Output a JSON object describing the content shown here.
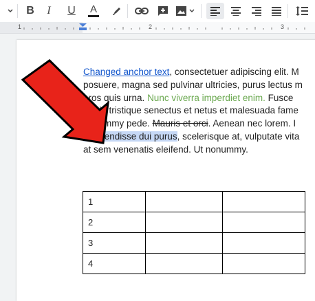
{
  "toolbar": {
    "buttons": [
      {
        "name": "bold-button",
        "label": "B"
      },
      {
        "name": "italic-button",
        "label": "I"
      },
      {
        "name": "underline-button",
        "label": "U"
      },
      {
        "name": "text-color-button",
        "label": "A"
      }
    ],
    "accent_color": "#1a1a1a"
  },
  "ruler": {
    "numbers": [
      "1",
      "2",
      "3"
    ]
  },
  "document": {
    "lines": [
      {
        "parts": [
          {
            "text": "Changed anchor text",
            "style": "link"
          },
          {
            "text": ", consectetuer adipiscing elit. M",
            "style": "normal"
          }
        ]
      },
      {
        "parts": [
          {
            "text": "posuere, magna sed pulvinar ultricies, purus lectus m",
            "style": "normal"
          }
        ]
      },
      {
        "parts": [
          {
            "text": "eros quis urna. ",
            "style": "normal"
          },
          {
            "text": "Nunc viverra imperdiet enim.",
            "style": "green"
          },
          {
            "text": " Fusce",
            "style": "normal"
          }
        ]
      },
      {
        "parts": [
          {
            "text": "Morbi tristique senectus et netus et malesuada fame",
            "style": "normal"
          }
        ]
      },
      {
        "parts": [
          {
            "text": "nonummy pede. ",
            "style": "normal"
          },
          {
            "text": "Mauris et orci",
            "style": "strike"
          },
          {
            "text": ". Aenean nec lorem. I",
            "style": "normal"
          }
        ]
      },
      {
        "parts": [
          {
            "text": "Suspendisse dui purus",
            "style": "selected"
          },
          {
            "text": ", scelerisque at, vulputate vita",
            "style": "normal"
          }
        ]
      },
      {
        "parts": [
          {
            "text": "at sem venenatis eleifend. Ut nonummy.",
            "style": "normal"
          }
        ]
      }
    ],
    "table_rows": [
      [
        "1",
        "",
        ""
      ],
      [
        "2",
        "",
        ""
      ],
      [
        "3",
        "",
        ""
      ],
      [
        "4",
        "",
        ""
      ]
    ]
  },
  "colors": {
    "link": "#1155cc",
    "green_text": "#6aa84f",
    "selection": "#c6d8f5",
    "arrow": "#e8231a"
  }
}
